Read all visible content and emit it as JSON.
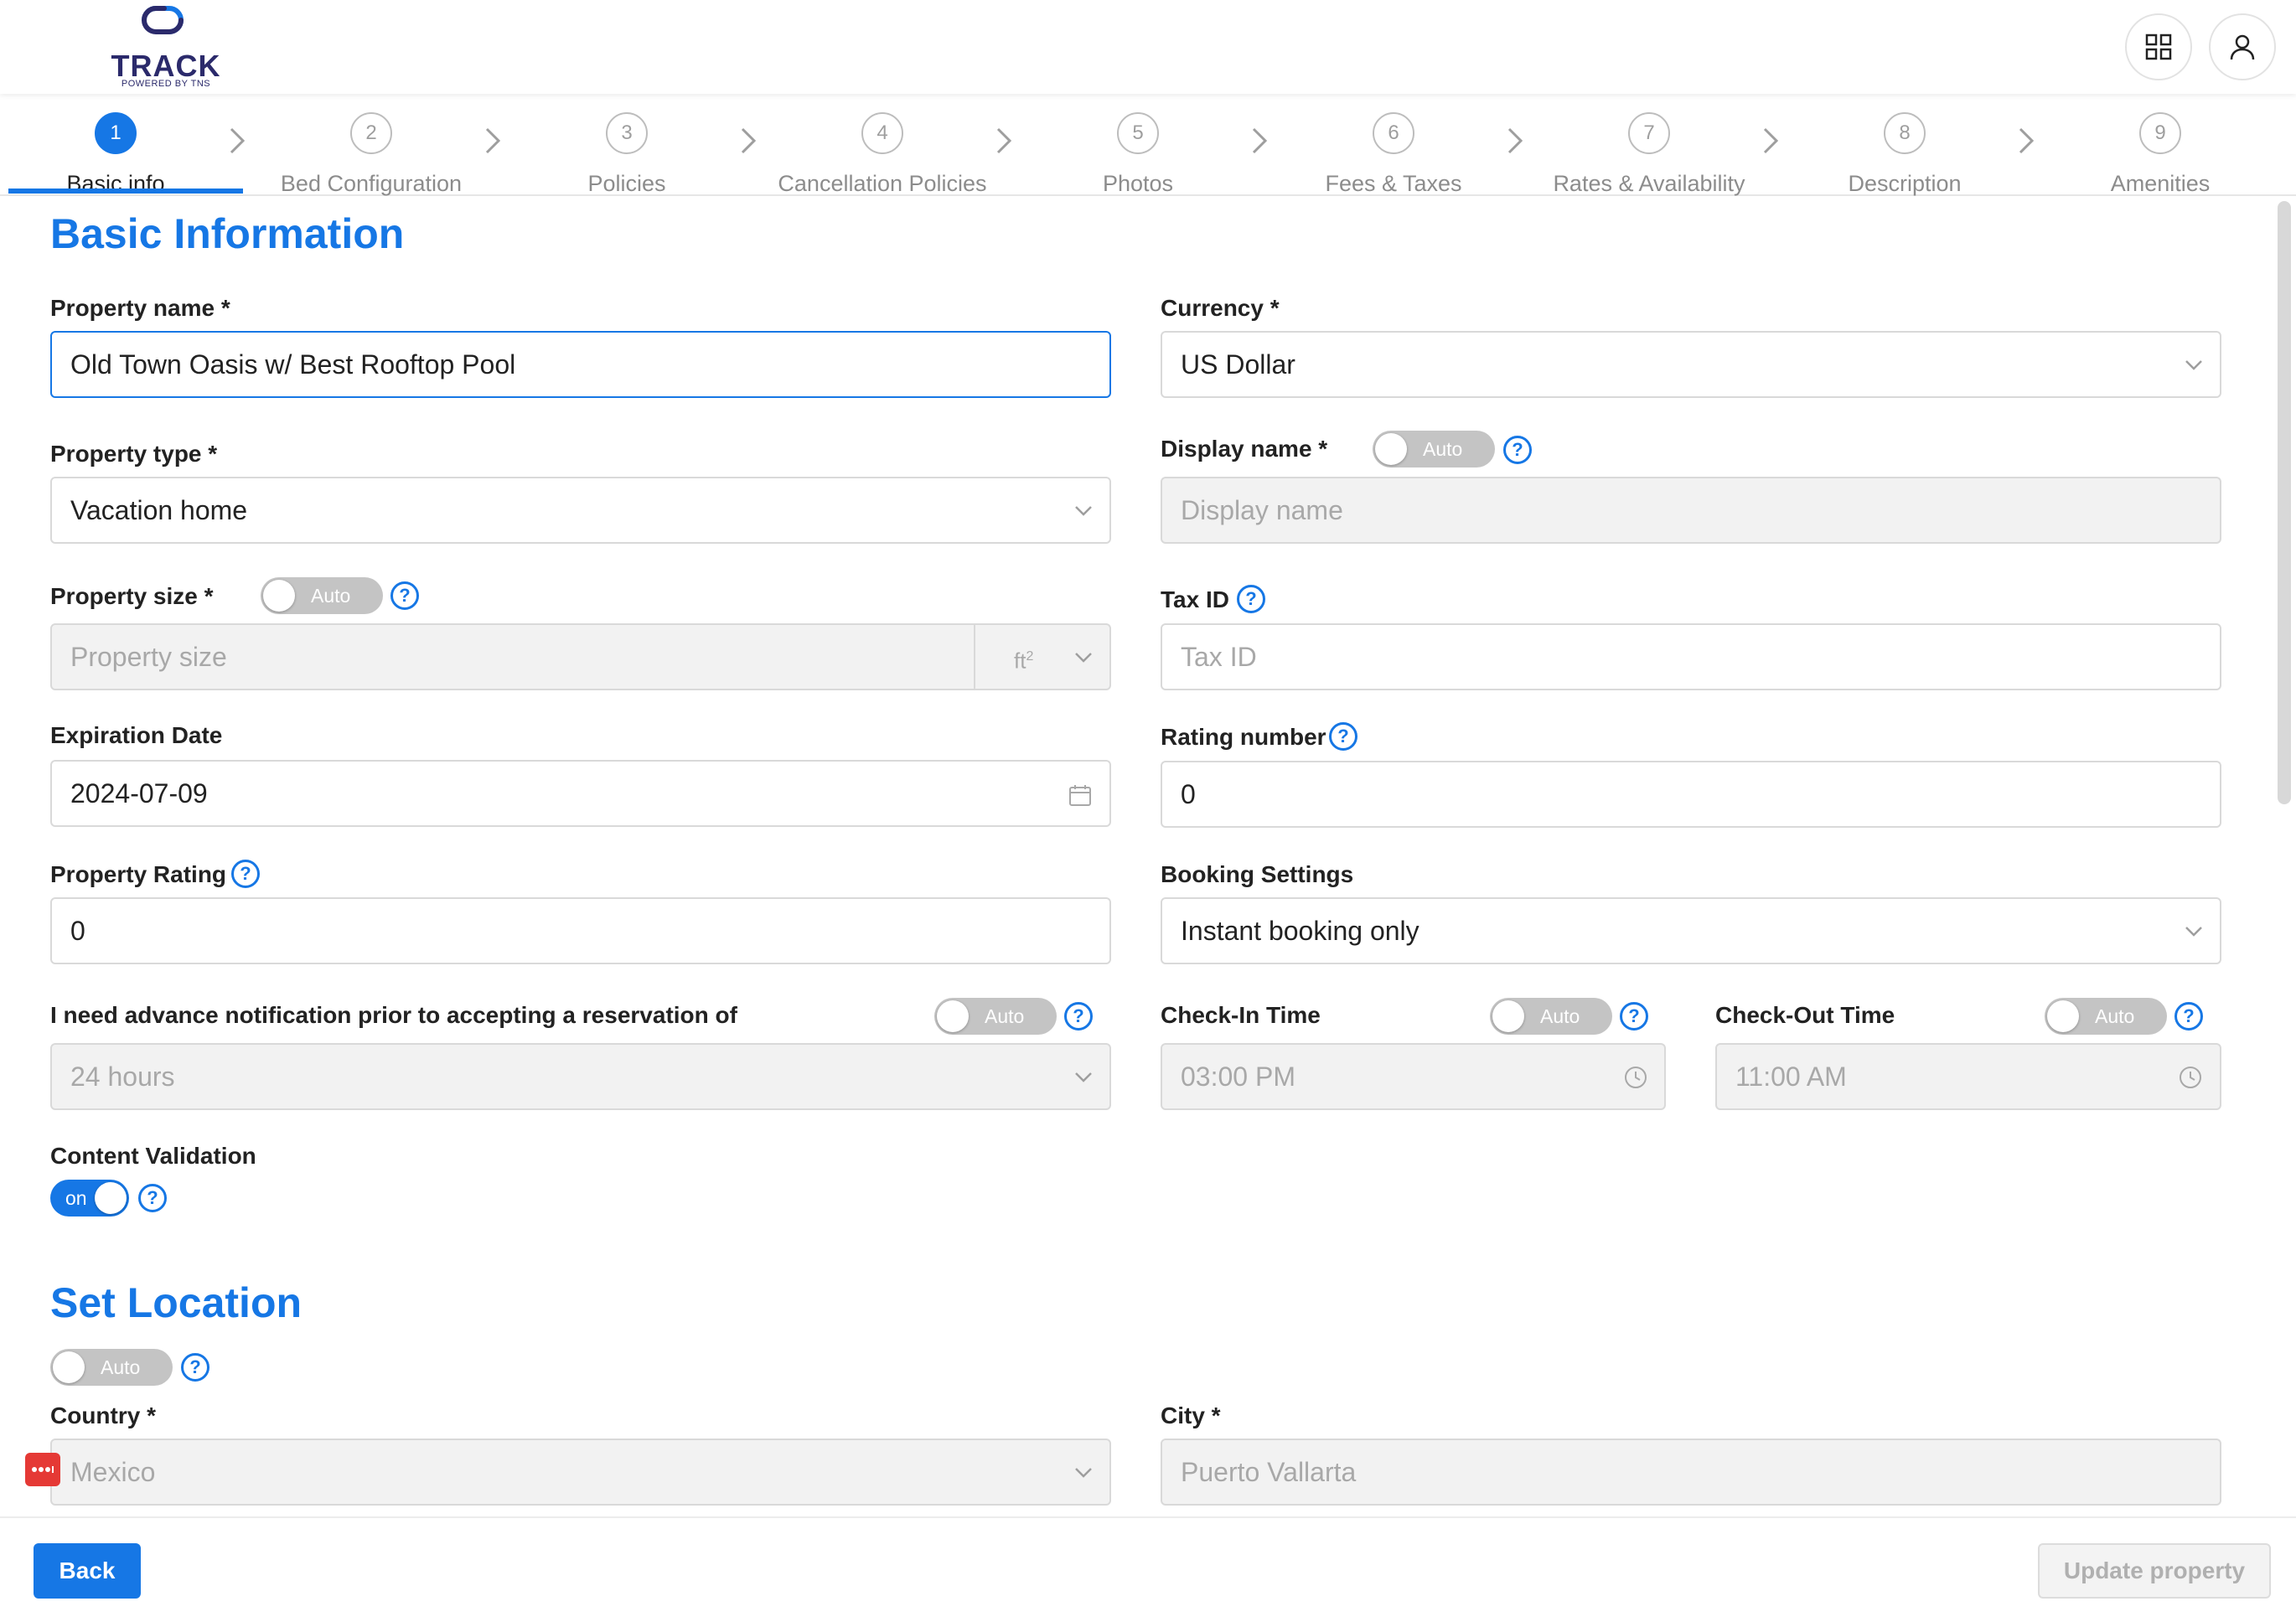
{
  "header": {
    "logo_text": "TRACK",
    "logo_sub": "POWERED BY TNS",
    "apps_icon": "grid-icon",
    "user_icon": "user-icon"
  },
  "steps": [
    {
      "number": "1",
      "label": "Basic info",
      "active": true
    },
    {
      "number": "2",
      "label": "Bed Configuration",
      "active": false
    },
    {
      "number": "3",
      "label": "Policies",
      "active": false
    },
    {
      "number": "4",
      "label": "Cancellation Policies",
      "active": false
    },
    {
      "number": "5",
      "label": "Photos",
      "active": false
    },
    {
      "number": "6",
      "label": "Fees & Taxes",
      "active": false
    },
    {
      "number": "7",
      "label": "Rates & Availability",
      "active": false
    },
    {
      "number": "8",
      "label": "Description",
      "active": false
    },
    {
      "number": "9",
      "label": "Amenities",
      "active": false
    }
  ],
  "basic": {
    "title": "Basic Information",
    "property_name": {
      "label": "Property name *",
      "value": "Old Town Oasis w/ Best Rooftop Pool"
    },
    "currency": {
      "label": "Currency *",
      "value": "US Dollar"
    },
    "property_type": {
      "label": "Property type *",
      "value": "Vacation home"
    },
    "display_name": {
      "label": "Display name *",
      "toggle": "Auto",
      "placeholder": "Display name"
    },
    "property_size": {
      "label": "Property size *",
      "toggle": "Auto",
      "placeholder": "Property size",
      "unit": "ft",
      "unit_sup": "2"
    },
    "tax_id": {
      "label": "Tax ID",
      "placeholder": "Tax ID"
    },
    "expiration_date": {
      "label": "Expiration Date",
      "value": "2024-07-09"
    },
    "rating_number": {
      "label": "Rating number",
      "value": "0"
    },
    "property_rating": {
      "label": "Property Rating",
      "value": "0"
    },
    "booking_settings": {
      "label": "Booking Settings",
      "value": "Instant booking only"
    },
    "advance_notice": {
      "label": "I need advance notification prior to accepting a reservation of",
      "toggle": "Auto",
      "value": "24 hours"
    },
    "check_in": {
      "label": "Check-In Time",
      "toggle": "Auto",
      "value": "03:00 PM"
    },
    "check_out": {
      "label": "Check-Out Time",
      "toggle": "Auto",
      "value": "11:00 AM"
    },
    "content_validation": {
      "label": "Content Validation",
      "toggle": "on"
    }
  },
  "location": {
    "title": "Set Location",
    "toggle": "Auto",
    "country": {
      "label": "Country *",
      "value": "Mexico"
    },
    "city": {
      "label": "City *",
      "value": "Puerto Vallarta"
    }
  },
  "footer": {
    "back_label": "Back",
    "update_label": "Update property"
  },
  "help_glyph": "?",
  "colors": {
    "accent": "#1677e5",
    "brand": "#2b2a6b"
  }
}
